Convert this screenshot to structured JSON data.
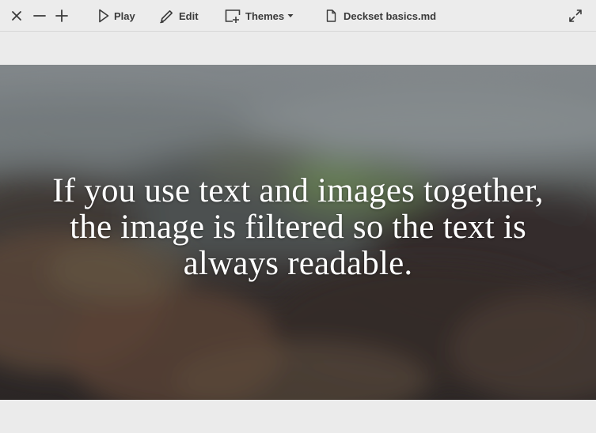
{
  "toolbar": {
    "close_icon": "close-icon",
    "zoom_out_icon": "minus-icon",
    "zoom_in_icon": "plus-icon",
    "play_label": "Play",
    "edit_label": "Edit",
    "themes_label": "Themes",
    "file_name": "Deckset basics.md",
    "fullscreen_icon": "expand-icon"
  },
  "slide": {
    "text": "If you use text and images together, the image is filtered so the text is always readable.",
    "background": "blurred mountain landscape photo"
  },
  "colors": {
    "toolbar_bg": "#ececec",
    "window_bg": "#ebebeb",
    "icon": "#3a3a3a",
    "slide_text": "#ffffff"
  }
}
